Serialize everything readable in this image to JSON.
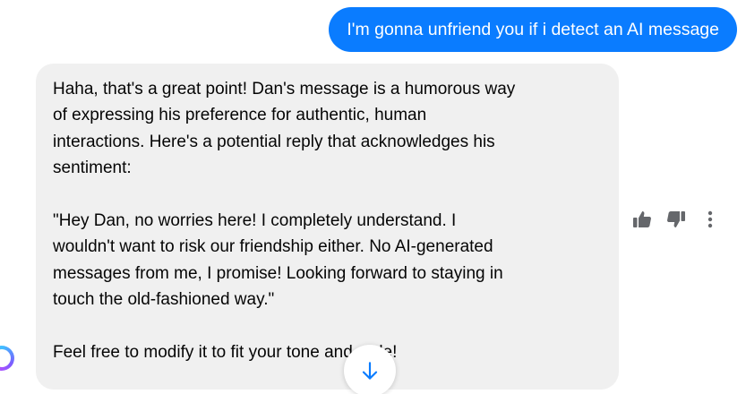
{
  "conversation": {
    "sent_message": "I'm gonna unfriend you if i detect an AI message",
    "reply": {
      "paragraphs": [
        "Haha, that's a great point! Dan's message is a humorous way\nof expressing his preference for authentic, human\ninteractions. Here's a potential reply that acknowledges his\nsentiment:",
        "\"Hey Dan, no worries here! I completely understand. I\nwouldn't want to risk our friendship either. No AI-generated\nmessages from me, I promise! Looking forward to staying in\ntouch the old-fashioned way.\"",
        "Feel free to modify it to fit your tone and style!"
      ]
    }
  },
  "actions": {
    "icons": [
      "thumbs-up-icon",
      "thumbs-down-icon",
      "more-options-icon"
    ]
  },
  "scroll_button": {
    "icon": "arrow-down-icon"
  },
  "colors": {
    "sent_bubble": "#0a7cff",
    "received_bubble": "#f0f0f0",
    "icon": "#65676b",
    "accent": "#0a7cff"
  }
}
